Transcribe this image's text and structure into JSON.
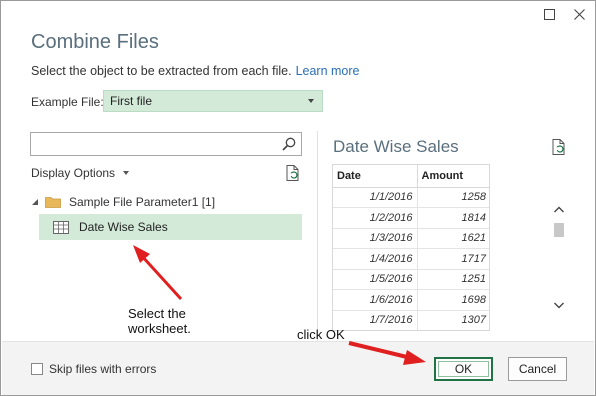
{
  "dialog": {
    "title": "Combine Files",
    "subtitle": "Select the object to be extracted from each file.",
    "learn_more": "Learn more"
  },
  "window_controls": {
    "maximize_icon": "maximize-icon",
    "close_icon": "close-icon"
  },
  "example_file": {
    "label": "Example File:",
    "value": "First file"
  },
  "navigator": {
    "search_placeholder": "",
    "display_options_label": "Display Options",
    "folder_label": "Sample File Parameter1 [1]",
    "sheet_label": "Date Wise Sales"
  },
  "preview": {
    "title": "Date Wise Sales",
    "columns": [
      "Date",
      "Amount"
    ],
    "rows": [
      [
        "1/1/2016",
        "1258"
      ],
      [
        "1/2/2016",
        "1814"
      ],
      [
        "1/3/2016",
        "1621"
      ],
      [
        "1/4/2016",
        "1717"
      ],
      [
        "1/5/2016",
        "1251"
      ],
      [
        "1/6/2016",
        "1698"
      ],
      [
        "1/7/2016",
        "1307"
      ]
    ]
  },
  "annotations": {
    "select_line1": "Select the",
    "select_line2": "worksheet.",
    "click_ok": "click OK"
  },
  "footer": {
    "skip_label": "Skip files with errors",
    "ok_label": "OK",
    "cancel_label": "Cancel"
  },
  "colors": {
    "selection_green": "#d3ead8",
    "title_slate": "#5a6f7d",
    "link_blue": "#2a6fb8",
    "annotation_red": "#e02020",
    "ok_border": "#217346"
  }
}
